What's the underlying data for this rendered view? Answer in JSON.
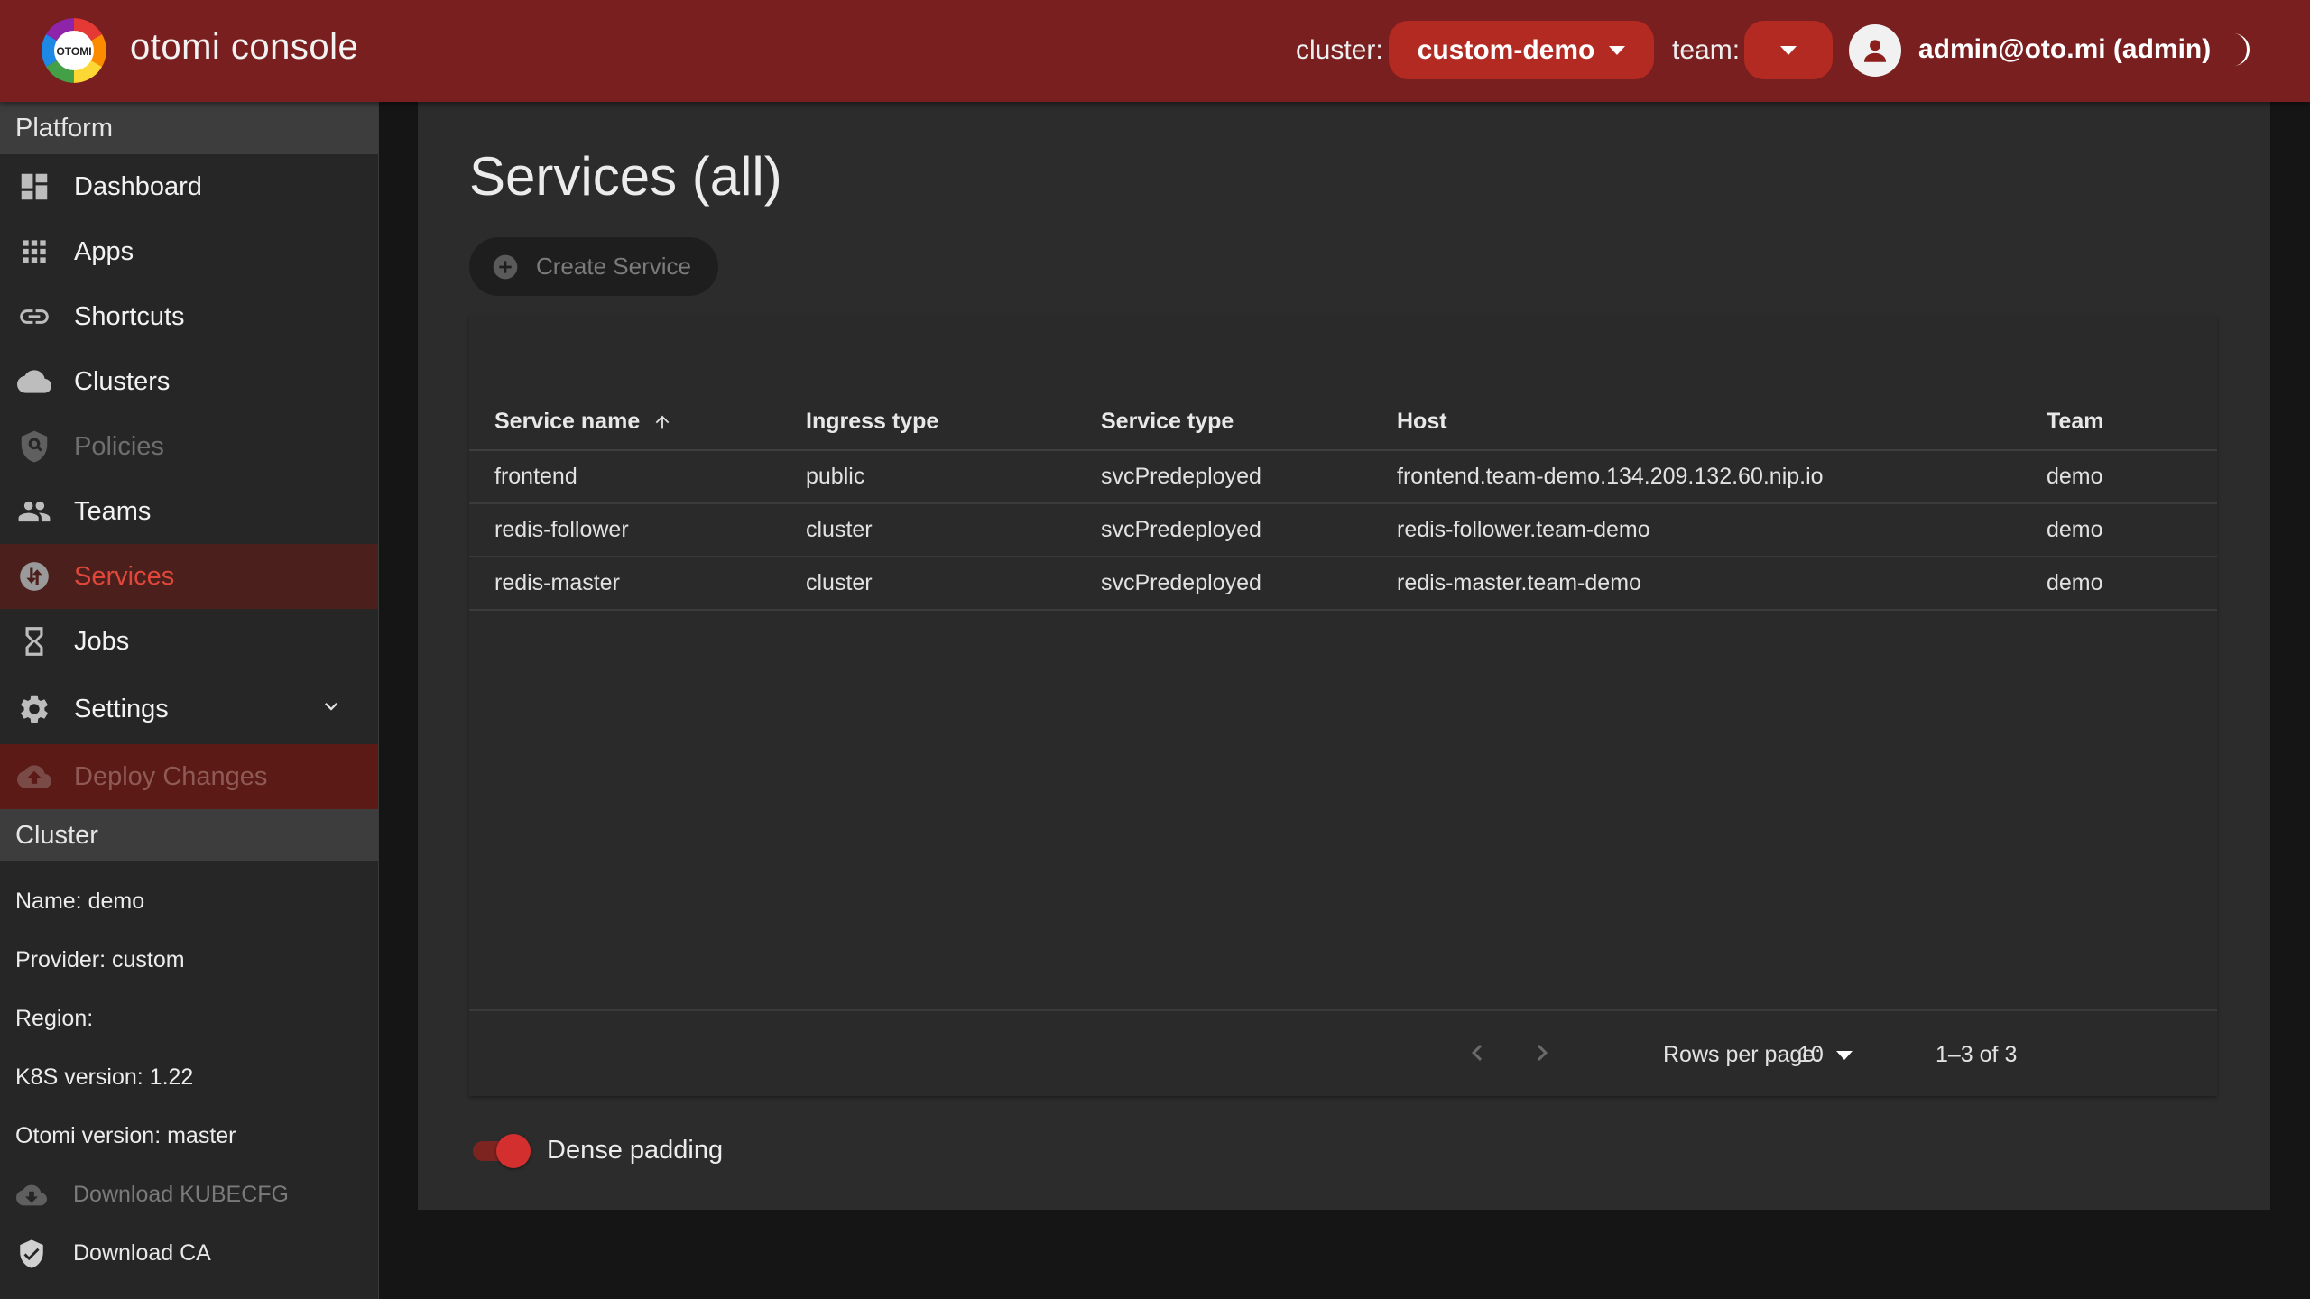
{
  "header": {
    "brand": "otomi console",
    "logo_text": "OTOMI",
    "cluster_label": "cluster:",
    "cluster_value": "custom-demo",
    "team_label": "team:",
    "team_value": "",
    "user": "admin@oto.mi (admin)",
    "theme_icon": "moon-icon",
    "colors": {
      "topbar": "#7a1f1f",
      "select": "#b22a22"
    }
  },
  "sidebar": {
    "platform_header": "Platform",
    "items": [
      {
        "label": "Dashboard",
        "icon": "dashboard-icon",
        "state": "normal"
      },
      {
        "label": "Apps",
        "icon": "apps-grid-icon",
        "state": "normal"
      },
      {
        "label": "Shortcuts",
        "icon": "link-icon",
        "state": "normal"
      },
      {
        "label": "Clusters",
        "icon": "cloud-icon",
        "state": "normal"
      },
      {
        "label": "Policies",
        "icon": "policy-icon",
        "state": "disabled"
      },
      {
        "label": "Teams",
        "icon": "people-icon",
        "state": "normal"
      },
      {
        "label": "Services",
        "icon": "services-icon",
        "state": "active"
      },
      {
        "label": "Jobs",
        "icon": "hourglass-icon",
        "state": "normal"
      },
      {
        "label": "Settings",
        "icon": "gear-icon",
        "state": "normal"
      },
      {
        "label": "Deploy Changes",
        "icon": "cloud-upload-icon",
        "state": "disabled"
      }
    ],
    "cluster_header": "Cluster",
    "cluster_info": [
      "Name: demo",
      "Provider: custom",
      "Region:",
      "K8S version: 1.22",
      "Otomi version: master"
    ],
    "downloads": [
      {
        "label": "Download KUBECFG",
        "icon": "cloud-download-icon",
        "state": "disabled"
      },
      {
        "label": "Download CA",
        "icon": "shield-check-icon",
        "state": "normal"
      }
    ]
  },
  "main": {
    "title": "Services (all)",
    "create_button": "Create Service",
    "table": {
      "columns": [
        "Service name",
        "Ingress type",
        "Service type",
        "Host",
        "Team"
      ],
      "rows": [
        [
          "frontend",
          "public",
          "svcPredeployed",
          "frontend.team-demo.134.209.132.60.nip.io",
          "demo"
        ],
        [
          "redis-follower",
          "cluster",
          "svcPredeployed",
          "redis-follower.team-demo",
          "demo"
        ],
        [
          "redis-master",
          "cluster",
          "svcPredeployed",
          "redis-master.team-demo",
          "demo"
        ]
      ]
    },
    "pagination": {
      "rows_per_page_label": "Rows per page:",
      "rows_per_page": "10",
      "range": "1–3 of 3"
    },
    "dense_padding_label": "Dense padding",
    "dense_padding_on": true
  }
}
